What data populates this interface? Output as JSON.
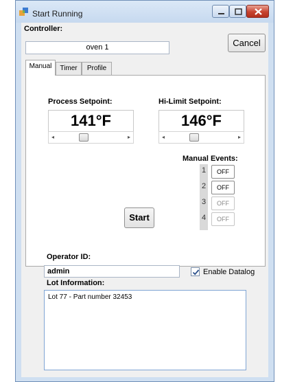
{
  "window": {
    "title": "Start Running",
    "accent": "#cfdff1",
    "close_color": "#c7432f"
  },
  "controller": {
    "label": "Controller:",
    "value": "oven 1"
  },
  "cancel_label": "Cancel",
  "tabs": [
    {
      "label": "Manual",
      "active": true
    },
    {
      "label": "Timer",
      "active": false
    },
    {
      "label": "Profile",
      "active": false
    }
  ],
  "manual": {
    "process_setpoint": {
      "label": "Process Setpoint:",
      "value": "141°F"
    },
    "hi_limit_setpoint": {
      "label": "Hi-Limit Setpoint:",
      "value": "146°F"
    },
    "events_label": "Manual Events:",
    "events": [
      {
        "number": "1",
        "state": "OFF",
        "enabled": true
      },
      {
        "number": "2",
        "state": "OFF",
        "enabled": true
      },
      {
        "number": "3",
        "state": "OFF",
        "enabled": false
      },
      {
        "number": "4",
        "state": "OFF",
        "enabled": false
      }
    ],
    "start_label": "Start"
  },
  "operator": {
    "label": "Operator ID:",
    "value": "admin"
  },
  "datalog": {
    "label": "Enable Datalog",
    "checked": true
  },
  "lot": {
    "label": "Lot Information:",
    "value": "Lot 77 - Part number 32453"
  }
}
